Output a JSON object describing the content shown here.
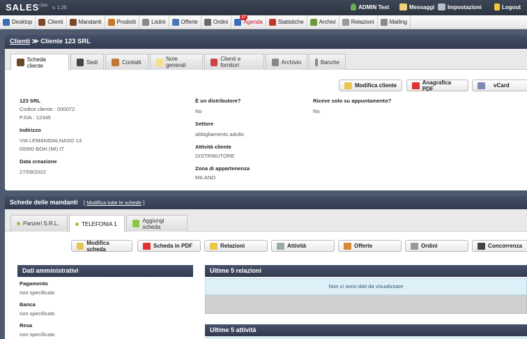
{
  "app": {
    "logo": "SALES",
    "logo_sup": "CRM",
    "version": "v. 1.25"
  },
  "topbar": {
    "user": "ADMIN Test",
    "messages": "Messaggi",
    "settings": "Impostazioni",
    "logout": "Logout"
  },
  "menu": [
    {
      "label": "Desktop",
      "color": "#3a6fb5"
    },
    {
      "label": "Clienti",
      "color": "#7a4a2a"
    },
    {
      "label": "Mandanti",
      "color": "#7a4a2a"
    },
    {
      "label": "Prodotti",
      "color": "#c8782a"
    },
    {
      "label": "Listini",
      "color": "#8a8a8a"
    },
    {
      "label": "Offerte",
      "color": "#4a7ab5"
    },
    {
      "label": "Ordini",
      "color": "#6a6a6a"
    },
    {
      "label": "Agenda",
      "color": "#3a6fb5",
      "badge": "17",
      "active": true
    },
    {
      "label": "Statistiche",
      "color": "#c0392b"
    },
    {
      "label": "Archivi",
      "color": "#6a9a3a"
    },
    {
      "label": "Relazioni",
      "color": "#9a9a9a"
    },
    {
      "label": "Mailing",
      "color": "#8a8a8a"
    }
  ],
  "breadcrumb": {
    "link": "Clienti",
    "sep": "≫",
    "current": "Cliente 123 SRL"
  },
  "client_tabs": [
    "Scheda cliente",
    "Sedi",
    "Contatti",
    "Note generali",
    "Clienti e fornitori",
    "Archivio",
    "Banche"
  ],
  "client_actions": {
    "edit": "Modifica cliente",
    "pdf": "Anagrafica PDF",
    "vcard": "vCard"
  },
  "client": {
    "name": "123 SRL",
    "code": "Codice cliente : 000072",
    "vat": "P.IVA : 12345",
    "address_label": "Indirizzo",
    "address1": "VIA LEMANIDALNASO 13",
    "address2": "00000 BOH (MI) IT",
    "created_label": "Data creazione",
    "created": "27/09/2022",
    "distributor_label": "È un distributore?",
    "distributor": "No",
    "sector_label": "Settore",
    "sector": "abbigliamento adulto",
    "activity_label": "Attività cliente",
    "activity": "DISTRIBUTORE",
    "zone_label": "Zona di appartenenza",
    "zone": "MILANO",
    "appointment_label": "Riceve solo su appuntamento?",
    "appointment": "No"
  },
  "mandanti": {
    "title": "Schede delle mandanti",
    "edit_all": "Modifica tutte le schede",
    "tabs": [
      "Panzeri S.R.L.",
      "TELEFONIA 1",
      "Aggiungi scheda"
    ],
    "actions": [
      "Modifica scheda",
      "Scheda in PDF",
      "Relazioni",
      "Attività",
      "Offerte",
      "Ordini",
      "Concorrenza"
    ]
  },
  "admin": {
    "title": "Dati amministrativi",
    "payment_label": "Pagamento",
    "payment": "non specificato",
    "bank_label": "Banca",
    "bank": "non specificato",
    "delivery_label": "Resa",
    "delivery": "non specificato"
  },
  "relations": {
    "title": "Ultime 5 relazioni",
    "empty": "Non ci sono dati da visualizzare"
  },
  "activities": {
    "title": "Ultime 5 attività"
  }
}
